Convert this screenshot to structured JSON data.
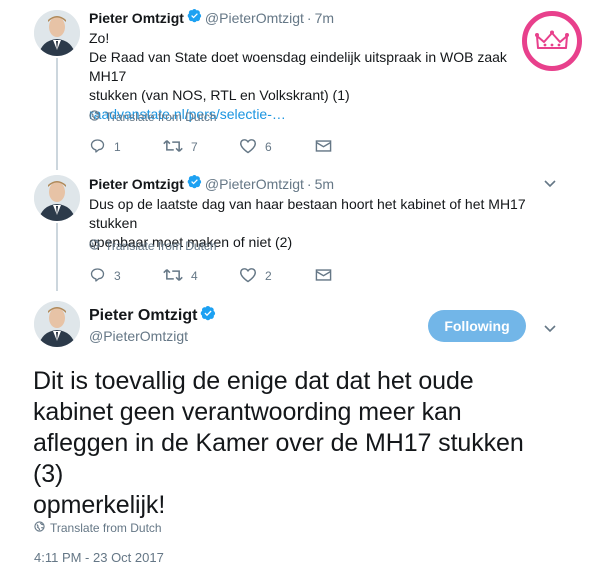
{
  "tweets": [
    {
      "name": "Pieter Omtzigt",
      "handle": "@PieterOmtzigt",
      "time": "7m",
      "lines": [
        "Zo!",
        "De Raad van State doet woensdag eindelijk uitspraak in WOB zaak MH17",
        "stukken (van NOS, RTL en Volkskrant) (1)"
      ],
      "link": "raadvanstate.nl/pers/selectie-…",
      "translate": "Translate from Dutch",
      "replies": "1",
      "retweets": "7",
      "likes": "6"
    },
    {
      "name": "Pieter Omtzigt",
      "handle": "@PieterOmtzigt",
      "time": "5m",
      "lines": [
        "Dus op de laatste dag van haar bestaan hoort het kabinet of het MH17 stukken",
        "openbaar moet maken of niet (2)"
      ],
      "translate": "Translate from Dutch",
      "replies": "3",
      "retweets": "4",
      "likes": "2"
    }
  ],
  "main_tweet": {
    "name": "Pieter Omtzigt",
    "handle": "@PieterOmtzigt",
    "follow_label": "Following",
    "lines": [
      "Dit is toevallig de enige dat dat het oude",
      "kabinet geen verantwoording meer kan",
      "afleggen in de Kamer over de MH17 stukken",
      "(3)",
      "opmerkelijk!"
    ],
    "translate": "Translate from Dutch",
    "timestamp": "4:11 PM - 23 Oct 2017"
  },
  "separator": "·",
  "colors": {
    "verified": "#1da1f2",
    "link": "#1b95e0",
    "follow_button": "#72b6e8",
    "badge": "#e8408c"
  },
  "icons": [
    "verified-icon",
    "globe-icon",
    "reply-icon",
    "retweet-icon",
    "like-icon",
    "dm-icon",
    "chevron-down-icon",
    "crown-badge-icon"
  ]
}
